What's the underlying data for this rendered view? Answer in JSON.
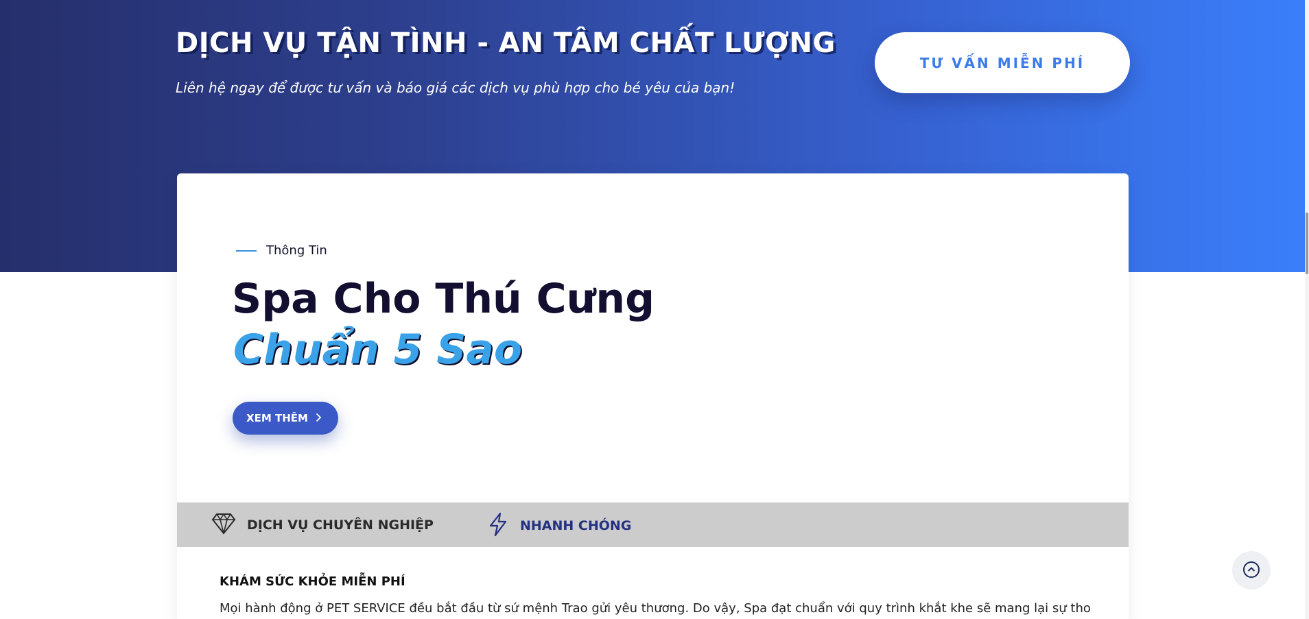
{
  "hero": {
    "title": "DỊCH VỤ TẬN TÌNH - AN TÂM CHẤT LƯỢNG",
    "subtitle": "Liên hệ ngay để được tư vấn và báo giá các dịch vụ phù hợp cho bé yêu của bạn!",
    "cta_label": "TƯ VẤN MIỄN PHÍ",
    "gradient_start": "#262f6c",
    "gradient_end": "#3a7ffb"
  },
  "card": {
    "eyebrow": "Thông Tin",
    "title_line1": "Spa Cho Thú Cưng",
    "title_line2": "Chuẩn 5 Sao",
    "more_label": "XEM THÊM",
    "accent": "#3aa2e8"
  },
  "features": [
    {
      "icon": "diamond-icon",
      "label": "DỊCH VỤ CHUYÊN NGHIỆP"
    },
    {
      "icon": "lightning-icon",
      "label": "NHANH CHÓNG"
    }
  ],
  "section": {
    "heading": "KHÁM SỨC KHỎE MIỄN PHÍ",
    "body": "Mọi hành động ở PET SERVICE đều bắt đầu từ sứ mệnh Trao gửi yêu thương. Do vậy, Spa đạt chuẩn với quy trình khắt khe sẽ mang lại sự thom"
  },
  "scroll_top": {
    "icon": "arrow-up-circle-icon"
  }
}
